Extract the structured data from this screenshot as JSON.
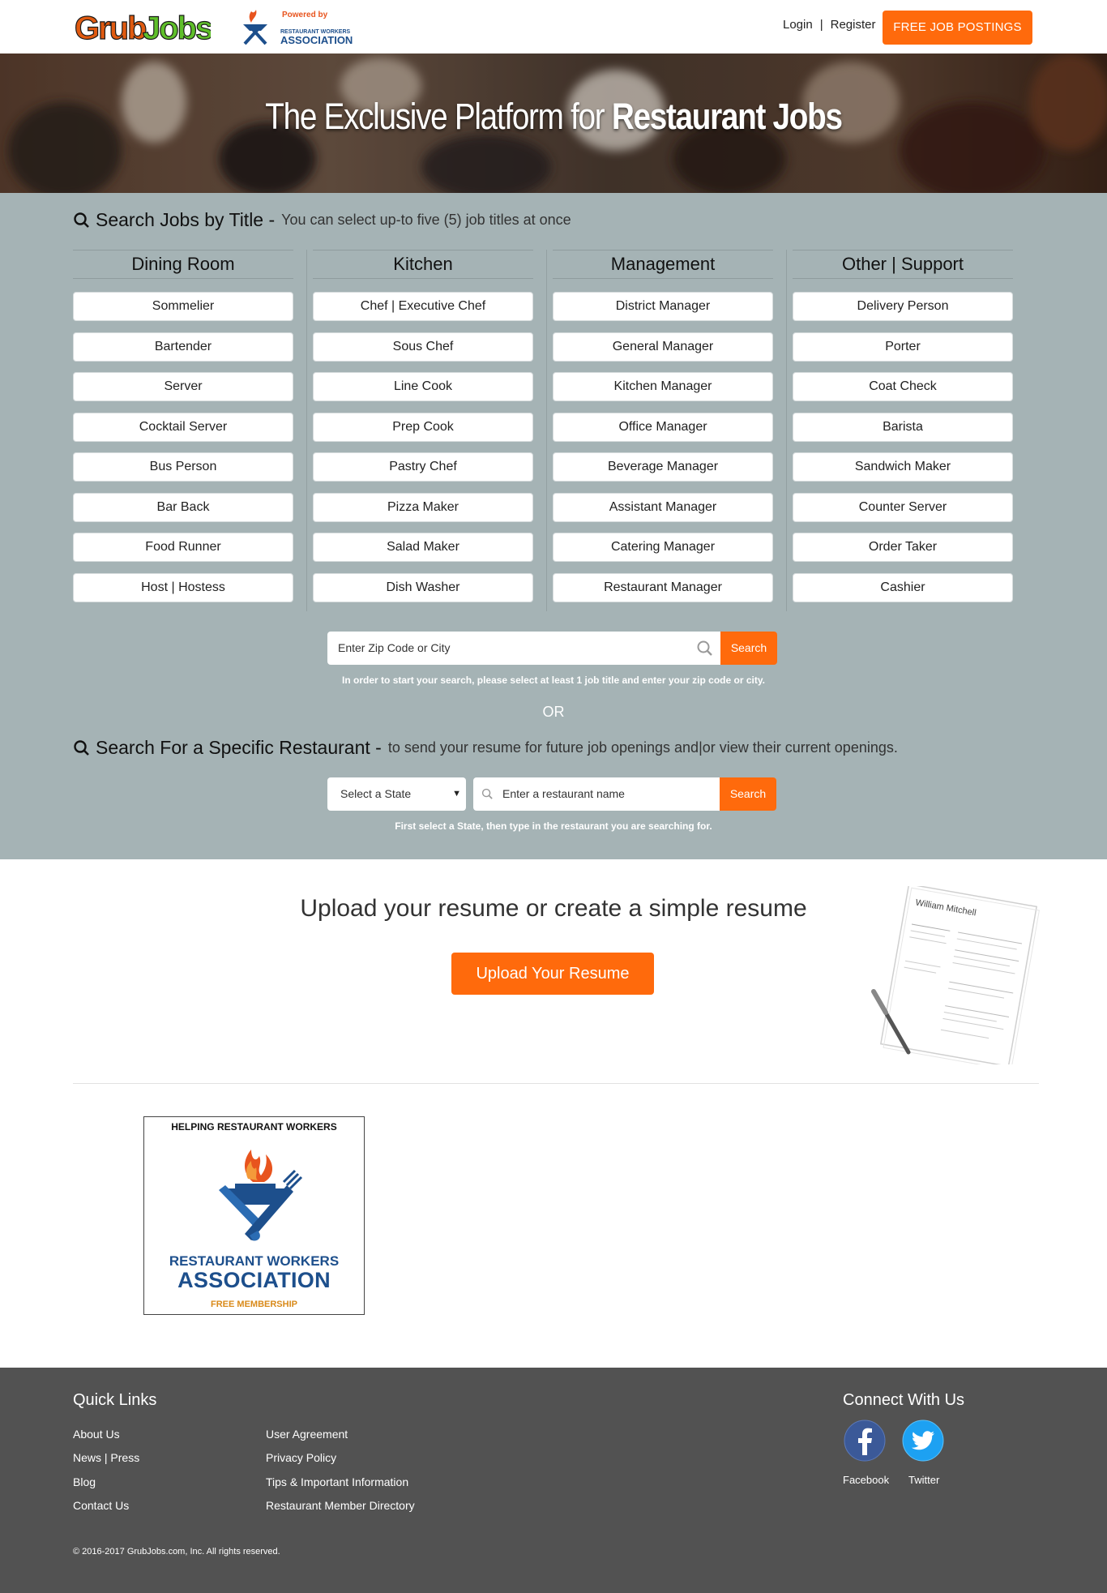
{
  "header": {
    "logo_text": "GrubJobs",
    "partner_powered": "Powered by",
    "partner_name_small": "RESTAURANT WORKERS",
    "partner_name_big": "ASSOCIATION",
    "login": "Login",
    "separator": "|",
    "register": "Register",
    "free_postings": "FREE JOB POSTINGS"
  },
  "hero": {
    "title_plain": "The Exclusive Platform for",
    "title_bold": "Restaurant Jobs"
  },
  "search_by_title": {
    "heading": "Search Jobs by Title -",
    "subheading": "You can select up-to five (5) job titles at once",
    "columns": [
      {
        "title": "Dining Room",
        "items": [
          "Sommelier",
          "Bartender",
          "Server",
          "Cocktail Server",
          "Bus Person",
          "Bar Back",
          "Food Runner",
          "Host | Hostess"
        ]
      },
      {
        "title": "Kitchen",
        "items": [
          "Chef | Executive Chef",
          "Sous Chef",
          "Line Cook",
          "Prep Cook",
          "Pastry Chef",
          "Pizza Maker",
          "Salad Maker",
          "Dish Washer"
        ]
      },
      {
        "title": "Management",
        "items": [
          "District Manager",
          "General Manager",
          "Kitchen Manager",
          "Office Manager",
          "Beverage Manager",
          "Assistant Manager",
          "Catering Manager",
          "Restaurant Manager"
        ]
      },
      {
        "title": "Other | Support",
        "items": [
          "Delivery Person",
          "Porter",
          "Coat Check",
          "Barista",
          "Sandwich Maker",
          "Counter Server",
          "Order Taker",
          "Cashier"
        ]
      }
    ],
    "zip_placeholder": "Enter Zip Code or City",
    "search_label": "Search",
    "hint": "In order to start your search, please select at least 1 job title and enter your zip code or city."
  },
  "or_text": "OR",
  "search_restaurant": {
    "heading": "Search For a Specific Restaurant -",
    "subheading": "to send your resume for future job openings and|or view their current openings.",
    "state_select": "Select a State",
    "name_placeholder": "Enter a restaurant name",
    "search_label": "Search",
    "hint": "First select a State, then type in the restaurant you are searching for."
  },
  "resume": {
    "heading": "Upload your resume or create a simple resume",
    "button": "Upload Your Resume",
    "paper_name": "William Mitchell"
  },
  "membership": {
    "top": "HELPING RESTAURANT WORKERS",
    "name1": "RESTAURANT WORKERS",
    "name2": "ASSOCIATION",
    "name3": "FREE MEMBERSHIP"
  },
  "footer": {
    "quick_links_title": "Quick Links",
    "links_col1": [
      "About Us",
      "News | Press",
      "Blog",
      "Contact Us"
    ],
    "links_col2": [
      "User Agreement",
      "Privacy Policy",
      "Tips & Important Information",
      "Restaurant Member Directory"
    ],
    "connect_title": "Connect With Us",
    "facebook": "Facebook",
    "twitter": "Twitter",
    "copyright": "© 2016-2017 GrubJobs.com, Inc. All rights reserved."
  },
  "colors": {
    "accent": "#ff6a0c",
    "panel": "#a5b3b5",
    "footer": "#525252",
    "facebook": "#3b5998",
    "twitter": "#1da1f2"
  }
}
